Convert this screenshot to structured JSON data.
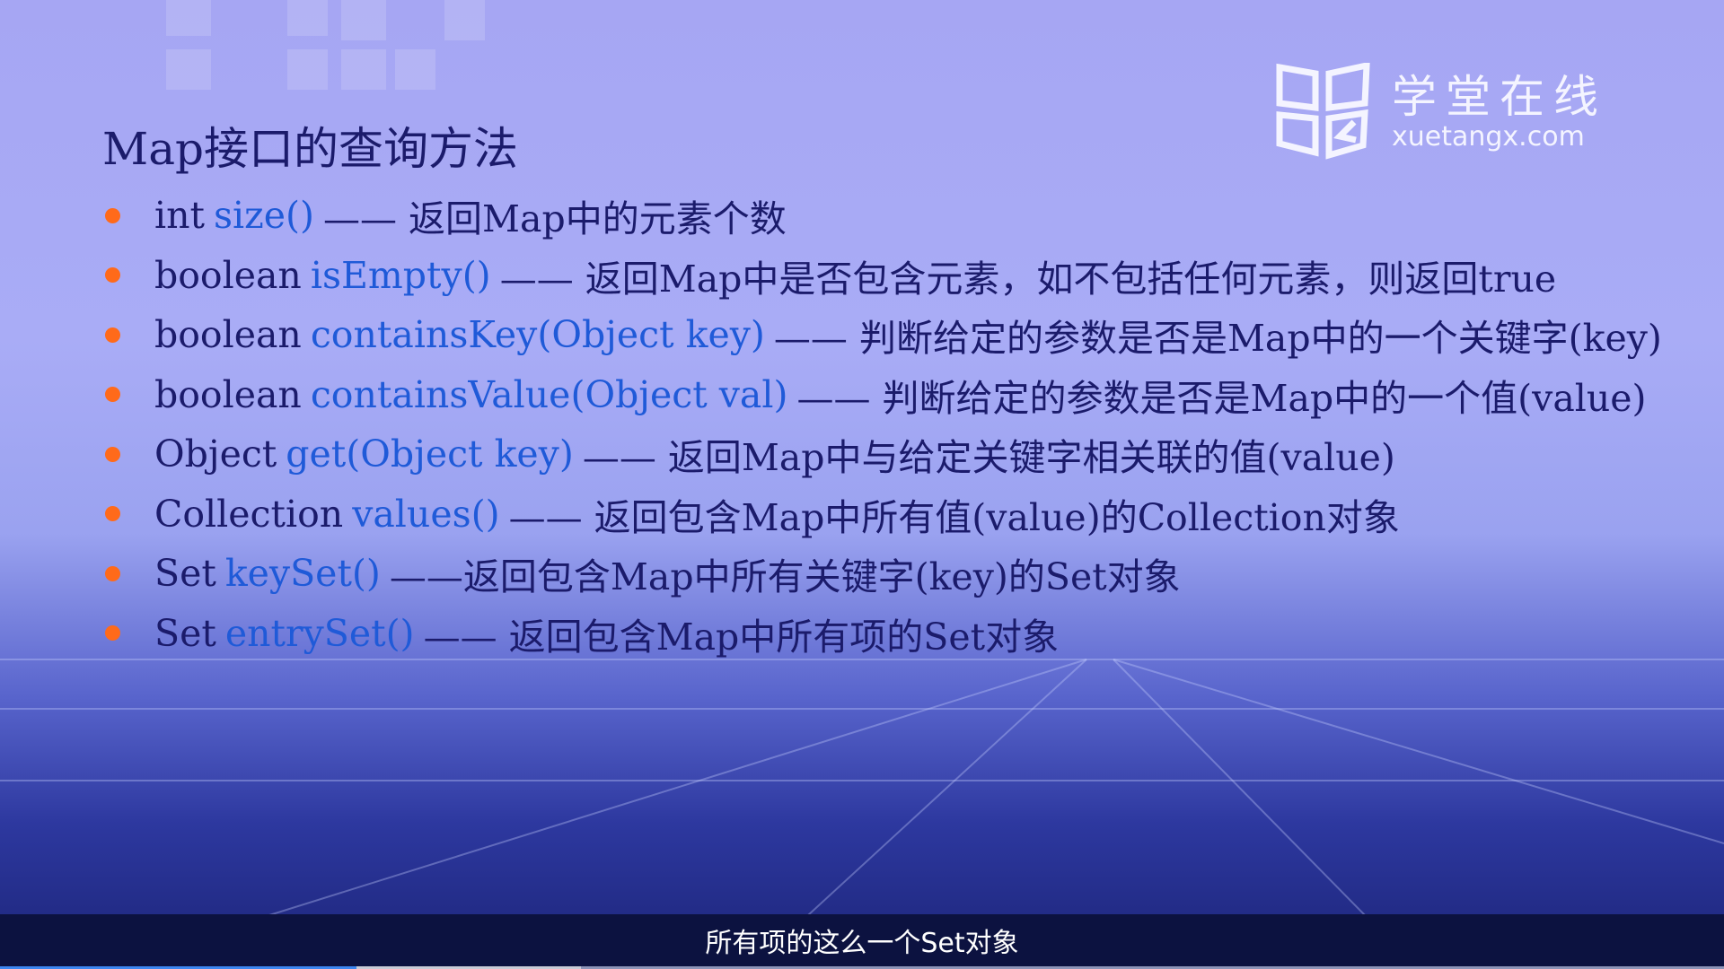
{
  "slide": {
    "title": "Map接口的查询方法",
    "items": [
      {
        "type": "int",
        "method": "size()",
        "desc": "—— 返回Map中的元素个数"
      },
      {
        "type": "boolean",
        "method": "isEmpty()",
        "desc": "—— 返回Map中是否包含元素，如不包括任何元素，则返回true"
      },
      {
        "type": "boolean",
        "method": "containsKey(Object key)",
        "desc": "—— 判断给定的参数是否是Map中的一个关键字(key)"
      },
      {
        "type": "boolean",
        "method": "containsValue(Object val)",
        "desc": "—— 判断给定的参数是否是Map中的一个值(value)"
      },
      {
        "type": "Object",
        "method": "get(Object key)",
        "desc": "—— 返回Map中与给定关键字相关联的值(value)"
      },
      {
        "type": "Collection",
        "method": "values()",
        "desc": "—— 返回包含Map中所有值(value)的Collection对象"
      },
      {
        "type": "Set",
        "method": "keySet()",
        "desc": "——返回包含Map中所有关键字(key)的Set对象"
      },
      {
        "type": "Set",
        "method": "entrySet()",
        "desc": "—— 返回包含Map中所有项的Set对象"
      }
    ]
  },
  "logo": {
    "cn": "学堂在线",
    "en": "xuetangx.com"
  },
  "subtitle": "所有项的这么一个Set对象",
  "player": {
    "played_fraction": 0.207,
    "buffered_fraction": 0.337
  },
  "colors": {
    "bullet": "#ff6a1a",
    "method": "#1f5ad8",
    "text": "#1b1b6b"
  }
}
